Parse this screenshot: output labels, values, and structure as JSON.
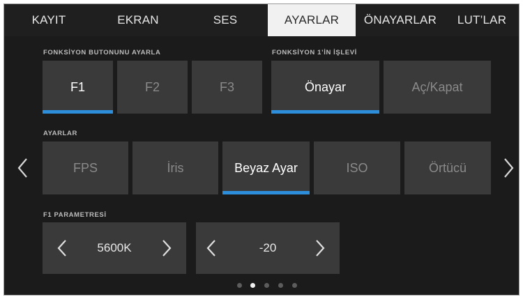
{
  "tabs": [
    {
      "label": "KAYIT"
    },
    {
      "label": "EKRAN"
    },
    {
      "label": "SES"
    },
    {
      "label": "AYARLAR"
    },
    {
      "label": "ÖNAYARLAR"
    },
    {
      "label": "LUT’LAR"
    }
  ],
  "active_tab": "AYARLAR",
  "function_buttons": {
    "label": "FONKSİYON BUTONUNU AYARLA",
    "items": [
      {
        "label": "F1",
        "selected": true
      },
      {
        "label": "F2",
        "selected": false
      },
      {
        "label": "F3",
        "selected": false
      }
    ]
  },
  "function_action": {
    "label": "FONKSİYON 1’İN İŞLEVİ",
    "items": [
      {
        "label": "Önayar",
        "selected": true
      },
      {
        "label": "Aç/Kapat",
        "selected": false
      }
    ]
  },
  "settings": {
    "label": "AYARLAR",
    "items": [
      {
        "label": "FPS",
        "selected": false
      },
      {
        "label": "İris",
        "selected": false
      },
      {
        "label": "Beyaz Ayar",
        "selected": true
      },
      {
        "label": "ISO",
        "selected": false
      },
      {
        "label": "Örtücü",
        "selected": false
      }
    ]
  },
  "parameter": {
    "label": "F1 PARAMETRESİ",
    "white_balance": "5600K",
    "tint": "-20"
  },
  "pagination": {
    "count": 5,
    "active_index": 1
  },
  "colors": {
    "accent": "#2d8fdc",
    "background": "#1b1b1b",
    "button": "#3a3a3a",
    "active_tab": "#f1f1f1"
  },
  "icons": {
    "left": "chevron-left-icon",
    "right": "chevron-right-icon"
  }
}
